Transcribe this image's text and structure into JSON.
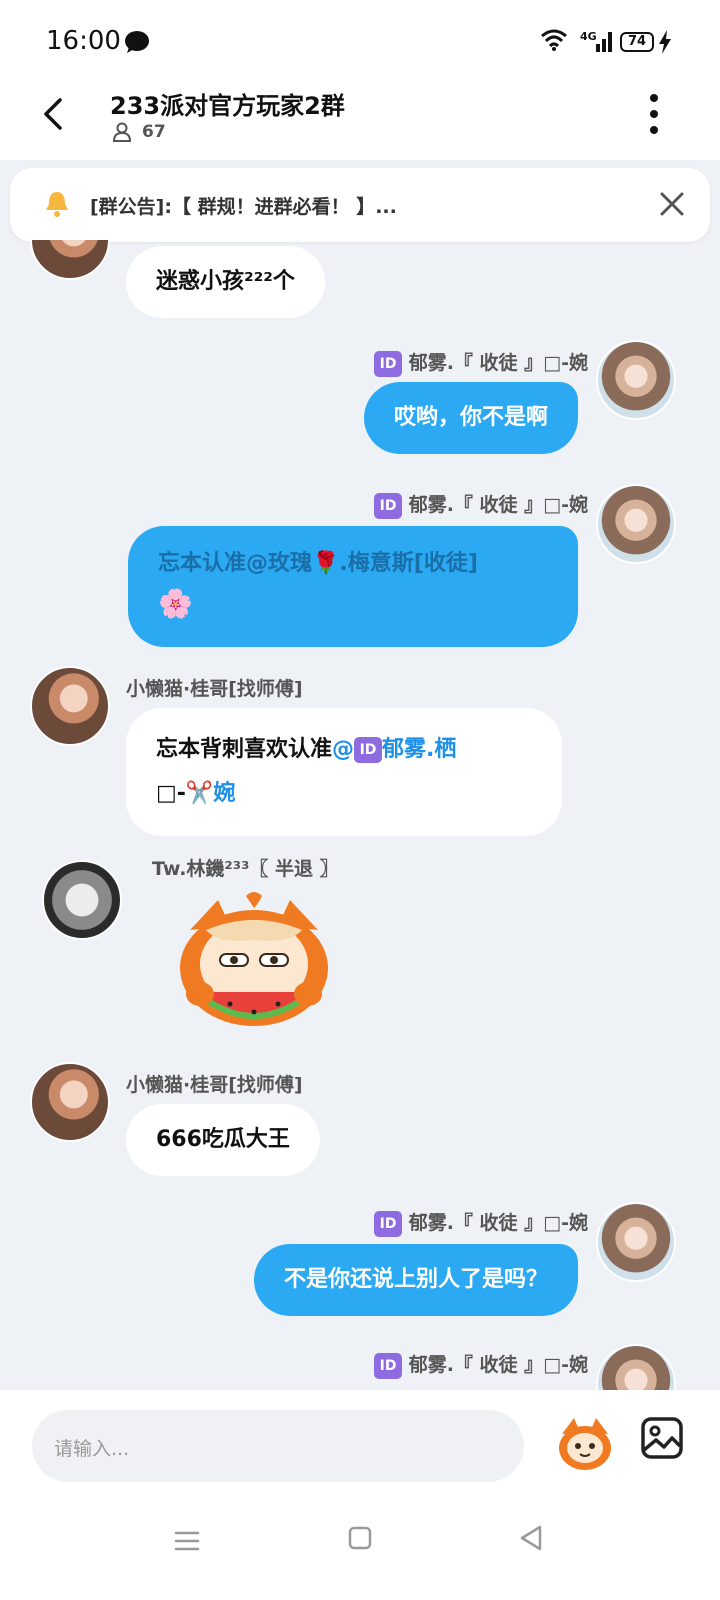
{
  "status": {
    "time": "16:00",
    "network": "4G",
    "battery": "74"
  },
  "header": {
    "title": "233派对官方玩家2群",
    "members": "67"
  },
  "notice": {
    "text": "[群公告]:【 群规！进群必看！ 】..."
  },
  "messages": [
    {
      "side": "left",
      "text": "迷惑小孩²²²个"
    },
    {
      "side": "right",
      "sender": "郁雾.『 收徒 』□-婉",
      "text": "哎哟，你不是啊"
    },
    {
      "side": "right",
      "sender": "郁雾.『 收徒 』□-婉",
      "text_a": "忘本认准@玫瑰",
      "text_b": ".梅意斯[收徒]"
    },
    {
      "side": "left",
      "sender": "小懒猫·桂哥[找师傅]",
      "text_a": "忘本背刺喜欢认准",
      "mention_a": "@",
      "mention_b": "郁雾.栖",
      "text_c": "□-",
      "mention_c": "婉"
    },
    {
      "side": "left",
      "sender": "Tw.林鐖²³³〖 半退 〗",
      "sticker": "watermelon-sticker"
    },
    {
      "side": "left",
      "sender": "小懒猫·桂哥[找师傅]",
      "text": "666吃瓜大王"
    },
    {
      "side": "right",
      "sender": "郁雾.『 收徒 』□-婉",
      "text": "不是你还说上别人了是吗？"
    },
    {
      "side": "right",
      "sender": "郁雾.『 收徒 』□-婉"
    }
  ],
  "id_badge": "ID",
  "input": {
    "placeholder": "请输入..."
  },
  "colors": {
    "accent": "#2BA9F2",
    "bg": "#EEF1F6",
    "badge": "#8E6BE0"
  }
}
